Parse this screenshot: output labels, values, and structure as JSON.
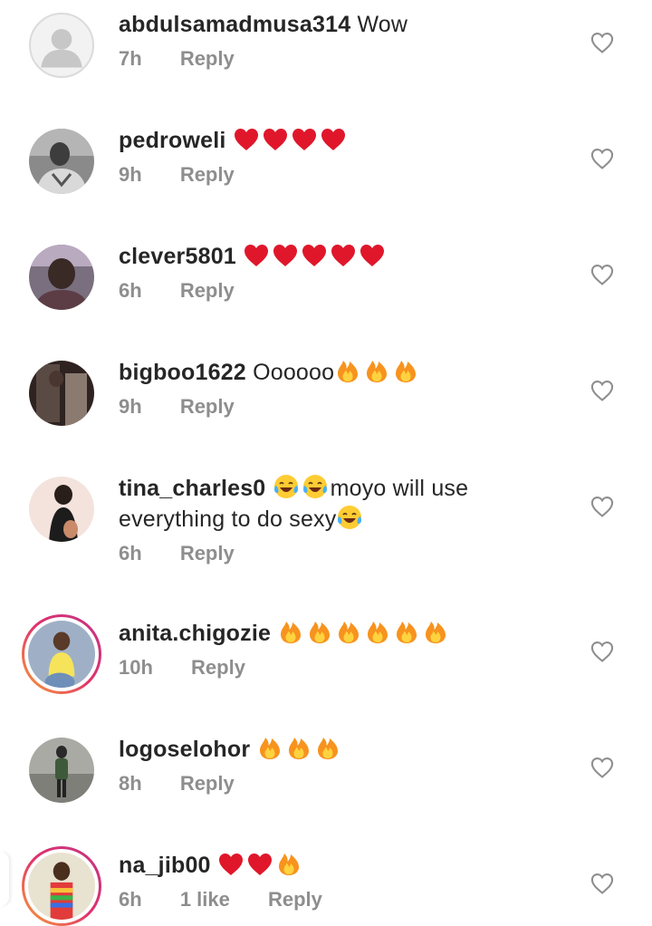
{
  "comments": [
    {
      "username": "abdulsamadmusa314",
      "text": "Wow",
      "emojis": [],
      "time": "7h",
      "likes": "",
      "reply_label": "Reply",
      "avatar": "placeholder-avatar"
    },
    {
      "username": "pedroweli",
      "text": "",
      "emojis": [
        "red-heart",
        "red-heart",
        "red-heart",
        "red-heart"
      ],
      "time": "9h",
      "likes": "",
      "reply_label": "Reply",
      "avatar": "photo-avatar"
    },
    {
      "username": "clever5801",
      "text": "",
      "emojis": [
        "red-heart",
        "red-heart",
        "red-heart",
        "red-heart",
        "red-heart"
      ],
      "time": "6h",
      "likes": "",
      "reply_label": "Reply",
      "avatar": "photo-avatar"
    },
    {
      "username": "bigboo1622",
      "text": "Oooooo",
      "emojis": [
        "fire",
        "fire",
        "fire"
      ],
      "time": "9h",
      "likes": "",
      "reply_label": "Reply",
      "avatar": "photo-avatar"
    },
    {
      "username": "tina_charles0",
      "text_line1_after": "moyo will use",
      "text_line2": "everything to do sexy",
      "time": "6h",
      "likes": "",
      "reply_label": "Reply",
      "avatar": "photo-avatar"
    },
    {
      "username": "anita.chigozie",
      "text": "",
      "emojis": [
        "fire",
        "fire",
        "fire",
        "fire",
        "fire",
        "fire"
      ],
      "time": "10h",
      "likes": "",
      "reply_label": "Reply",
      "avatar": "story-ring-avatar"
    },
    {
      "username": "logoselohor",
      "text": "",
      "emojis": [
        "fire",
        "fire",
        "fire"
      ],
      "time": "8h",
      "likes": "",
      "reply_label": "Reply",
      "avatar": "photo-avatar"
    },
    {
      "username": "na_jib00",
      "text": "",
      "emojis": [
        "red-heart",
        "red-heart",
        "fire"
      ],
      "time": "6h",
      "likes": "1 like",
      "reply_label": "Reply",
      "avatar": "story-ring-avatar"
    }
  ],
  "colors": {
    "text": "#262626",
    "meta": "#8e8e8e",
    "heart_outline": "#8e8e8e",
    "red_heart": "#e0172b",
    "fire_outer": "#f7931e",
    "fire_inner": "#ffd23f",
    "ring_gradient": [
      "#f7a234",
      "#e1306c",
      "#c13584"
    ]
  },
  "icons": {
    "like_button": "heart-outline-icon"
  }
}
